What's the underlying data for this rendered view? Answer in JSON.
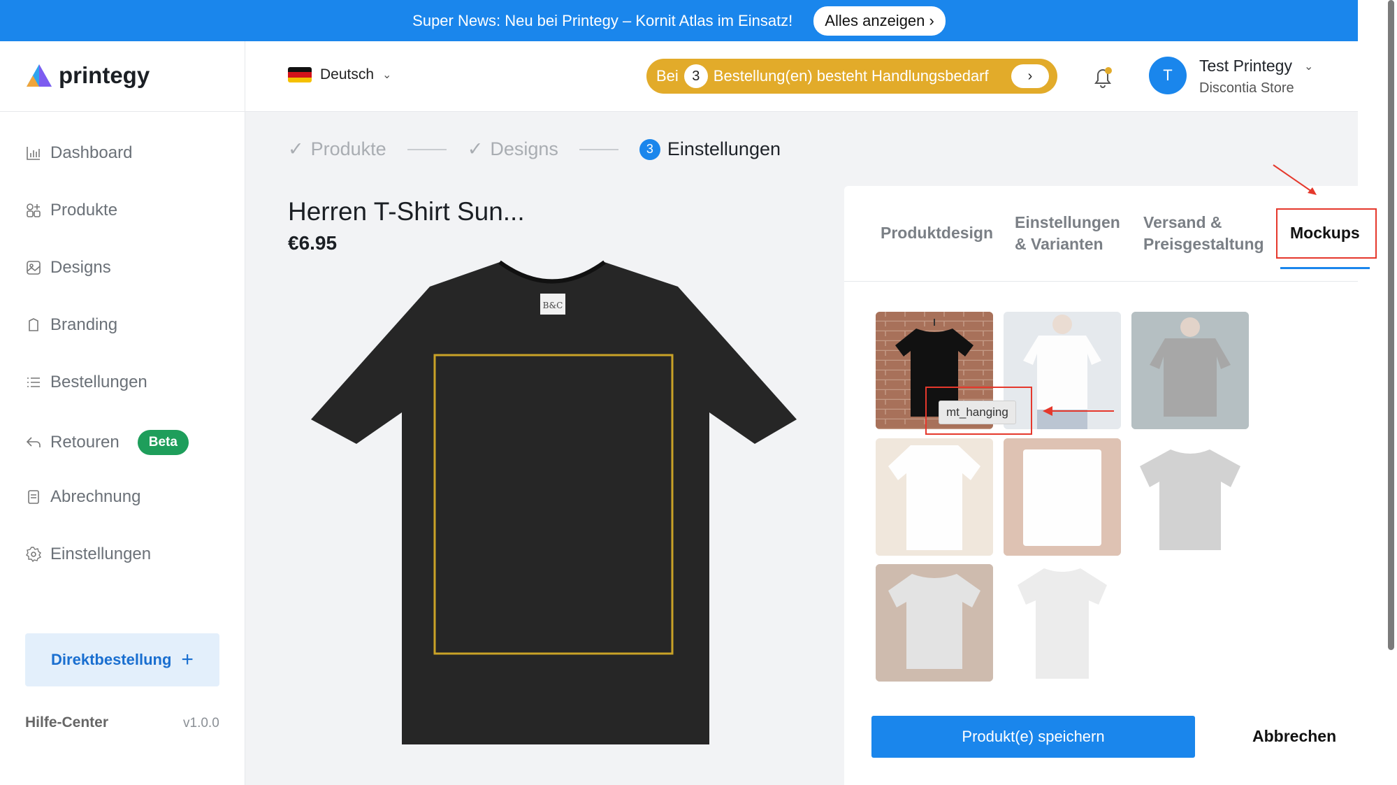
{
  "banner": {
    "text": "Super News: Neu bei Printegy – Kornit Atlas im Einsatz!",
    "button": "Alles anzeigen ›"
  },
  "brand": {
    "name": "printegy"
  },
  "language": {
    "label": "Deutsch",
    "caret": "⌄"
  },
  "alert": {
    "prefix": "Bei",
    "count": "3",
    "suffix": "Bestellung(en) besteht Handlungsbedarf",
    "go": "›"
  },
  "user": {
    "initial": "T",
    "name": "Test Printegy",
    "store": "Discontia Store",
    "caret": "⌄"
  },
  "sidebar": {
    "items": [
      {
        "label": "Dashboard",
        "icon": "chart-icon"
      },
      {
        "label": "Produkte",
        "icon": "grid-icon"
      },
      {
        "label": "Designs",
        "icon": "image-icon"
      },
      {
        "label": "Branding",
        "icon": "tag-icon"
      },
      {
        "label": "Bestellungen",
        "icon": "list-icon"
      },
      {
        "label": "Retouren",
        "icon": "return-icon",
        "badge": "Beta"
      },
      {
        "label": "Abrechnung",
        "icon": "receipt-icon"
      },
      {
        "label": "Einstellungen",
        "icon": "gear-icon"
      }
    ],
    "direct_order": "Direktbestellung",
    "direct_plus": "+",
    "help": "Hilfe-Center",
    "version": "v1.0.0"
  },
  "steps": [
    {
      "label": "Produkte",
      "state": "done"
    },
    {
      "label": "Designs",
      "state": "done"
    },
    {
      "label": "Einstellungen",
      "state": "active",
      "number": "3"
    }
  ],
  "product": {
    "title": "Herren T-Shirt Sun...",
    "price": "€6.95",
    "label_text": "B&C"
  },
  "tabs": [
    {
      "line1": "Produktdesign",
      "line2": ""
    },
    {
      "line1": "Einstellungen",
      "line2": "& Varianten"
    },
    {
      "line1": "Versand &",
      "line2": "Preisgestaltung"
    },
    {
      "line1": "Mockups",
      "line2": "",
      "active": true
    }
  ],
  "mockups": [
    {
      "name": "mt_hanging",
      "faded": false
    },
    {
      "name": "white-tee-model",
      "faded": true
    },
    {
      "name": "black-tee-model",
      "faded": true
    },
    {
      "name": "white-tee-wood",
      "faded": true
    },
    {
      "name": "white-tee-folded-wood",
      "faded": true
    },
    {
      "name": "grey-tee-flat",
      "faded": true
    },
    {
      "name": "grey-tee-table",
      "faded": true
    },
    {
      "name": "white-tee-plain",
      "faded": true
    }
  ],
  "tooltip": "mt_hanging",
  "actions": {
    "save": "Produkt(e) speichern",
    "cancel": "Abbrechen"
  },
  "colors": {
    "primary": "#1a86ec",
    "alert": "#e2ab2a",
    "beta": "#1e9e5b",
    "annotation": "#e5382c"
  }
}
